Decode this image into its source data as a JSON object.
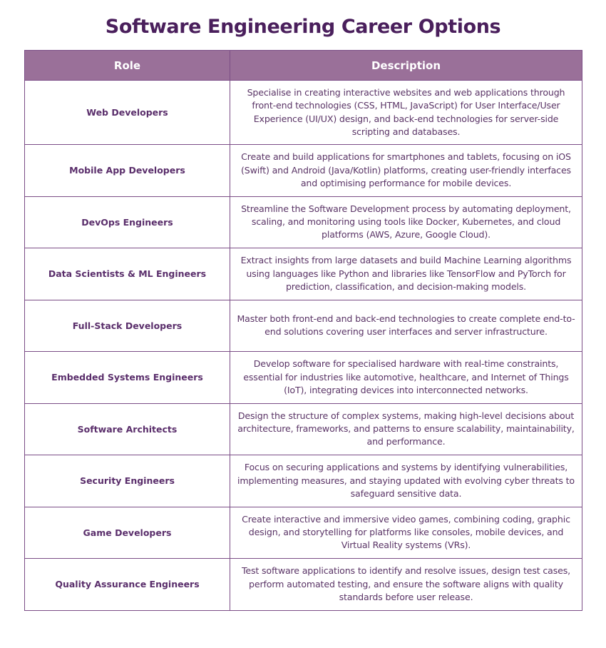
{
  "title": "Software Engineering Career Options",
  "colors": {
    "title": "#4a1f5c",
    "header_bg": "#9a7099",
    "header_text": "#ffffff",
    "border": "#7b4d86",
    "role_text": "#5a2e6b",
    "desc_text": "#5a3466"
  },
  "table": {
    "headers": {
      "role": "Role",
      "description": "Description"
    },
    "rows": [
      {
        "role": "Web Developers",
        "description": "Specialise in creating interactive websites and web applications through front-end technologies (CSS, HTML, JavaScript) for User Interface/User Experience (UI/UX) design, and back-end technologies for server-side scripting and databases."
      },
      {
        "role": "Mobile App Developers",
        "description": "Create and build applications for smartphones and tablets, focusing on iOS (Swift) and Android (Java/Kotlin) platforms, creating user-friendly interfaces and optimising performance for mobile devices."
      },
      {
        "role": "DevOps Engineers",
        "description": "Streamline the Software Development process by automating deployment, scaling, and monitoring using tools like Docker, Kubernetes, and cloud platforms (AWS, Azure, Google Cloud)."
      },
      {
        "role": "Data Scientists & ML Engineers",
        "description": "Extract insights from large datasets and build Machine Learning algorithms using languages like Python and libraries like TensorFlow and PyTorch for prediction, classification, and decision-making models."
      },
      {
        "role": "Full-Stack Developers",
        "description": "Master both front-end and back-end technologies to create complete end-to-end solutions covering user interfaces and server infrastructure."
      },
      {
        "role": "Embedded Systems Engineers",
        "description": "Develop software for specialised hardware with real-time constraints, essential for industries like automotive, healthcare, and Internet of Things (IoT), integrating devices into interconnected networks."
      },
      {
        "role": "Software Architects",
        "description": "Design the structure of complex systems, making high-level decisions about architecture, frameworks, and patterns to ensure scalability, maintainability, and performance."
      },
      {
        "role": "Security Engineers",
        "description": "Focus on securing applications and systems by identifying vulnerabilities, implementing measures, and staying updated with evolving cyber threats to safeguard sensitive data."
      },
      {
        "role": "Game Developers",
        "description": "Create interactive and immersive video games, combining coding, graphic design, and storytelling for platforms like consoles, mobile devices, and Virtual Reality systems (VRs)."
      },
      {
        "role": "Quality Assurance Engineers",
        "description": "Test software applications to identify and resolve issues, design test cases, perform automated testing, and ensure the software aligns with quality standards before user release."
      }
    ]
  }
}
